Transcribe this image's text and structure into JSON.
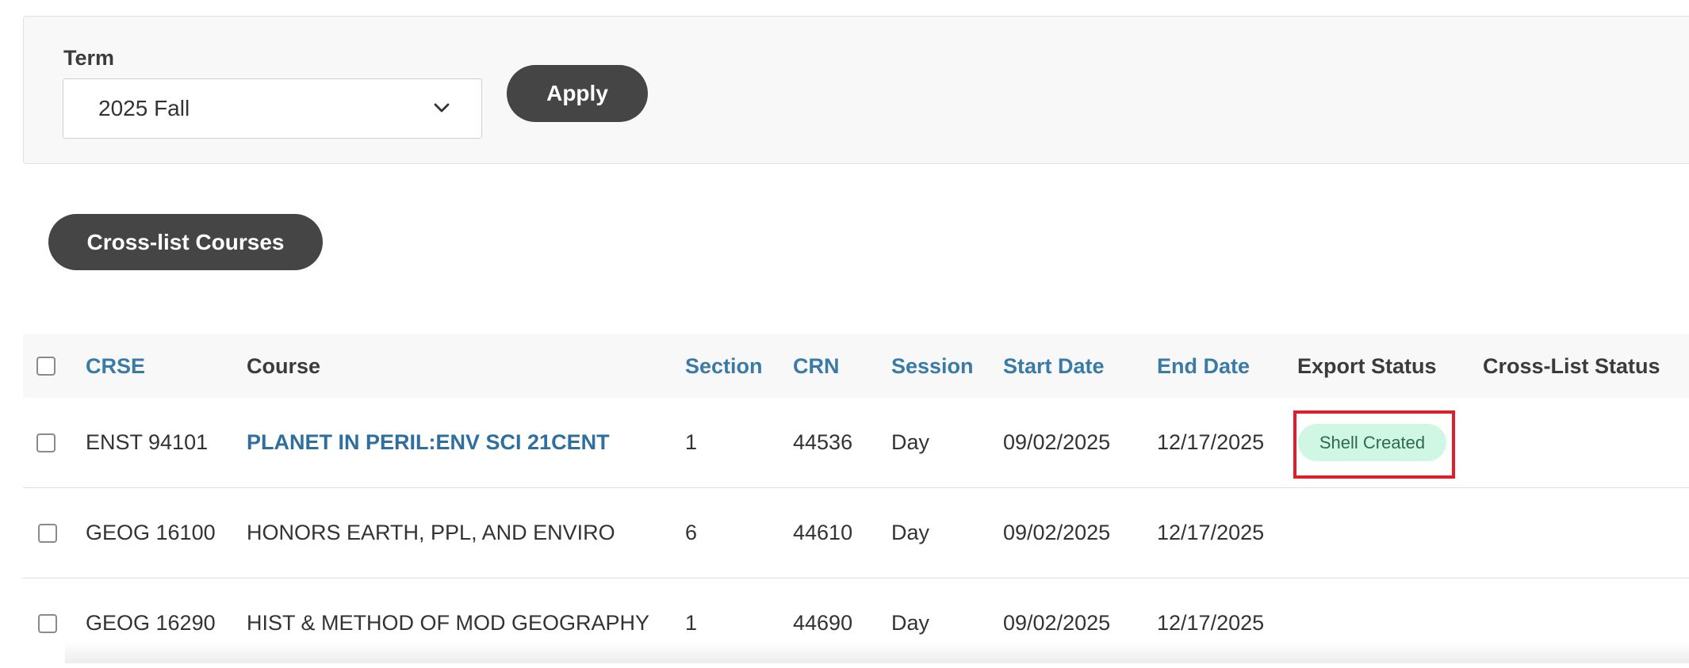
{
  "filter": {
    "term_label": "Term",
    "term_value": "2025 Fall",
    "apply_label": "Apply"
  },
  "actions": {
    "crosslist_label": "Cross-list Courses"
  },
  "table": {
    "headers": {
      "crse": "CRSE",
      "course": "Course",
      "section": "Section",
      "crn": "CRN",
      "session": "Session",
      "start": "Start Date",
      "end": "End Date",
      "export": "Export Status",
      "xlist": "Cross-List Status"
    },
    "rows": [
      {
        "crse": "ENST 94101",
        "course": "PLANET IN PERIL:ENV SCI 21CENT",
        "section": "1",
        "crn": "44536",
        "session": "Day",
        "start": "09/02/2025",
        "end": "12/17/2025",
        "export": "Shell Created",
        "xlist": ""
      },
      {
        "crse": "GEOG 16100",
        "course": "HONORS EARTH, PPL, AND ENVIRO",
        "section": "6",
        "crn": "44610",
        "session": "Day",
        "start": "09/02/2025",
        "end": "12/17/2025",
        "export": "",
        "xlist": ""
      },
      {
        "crse": "GEOG 16290",
        "course": "HIST & METHOD OF MOD GEOGRAPHY",
        "section": "1",
        "crn": "44690",
        "session": "Day",
        "start": "09/02/2025",
        "end": "12/17/2025",
        "export": "",
        "xlist": ""
      }
    ]
  },
  "colors": {
    "button_bg": "#454545",
    "link": "#3a7aa6",
    "badge_bg": "#cff7e4",
    "badge_text": "#2d6b4c",
    "highlight": "#e01e2a"
  },
  "icons": {
    "term_chevron": "chevron-down-icon"
  }
}
